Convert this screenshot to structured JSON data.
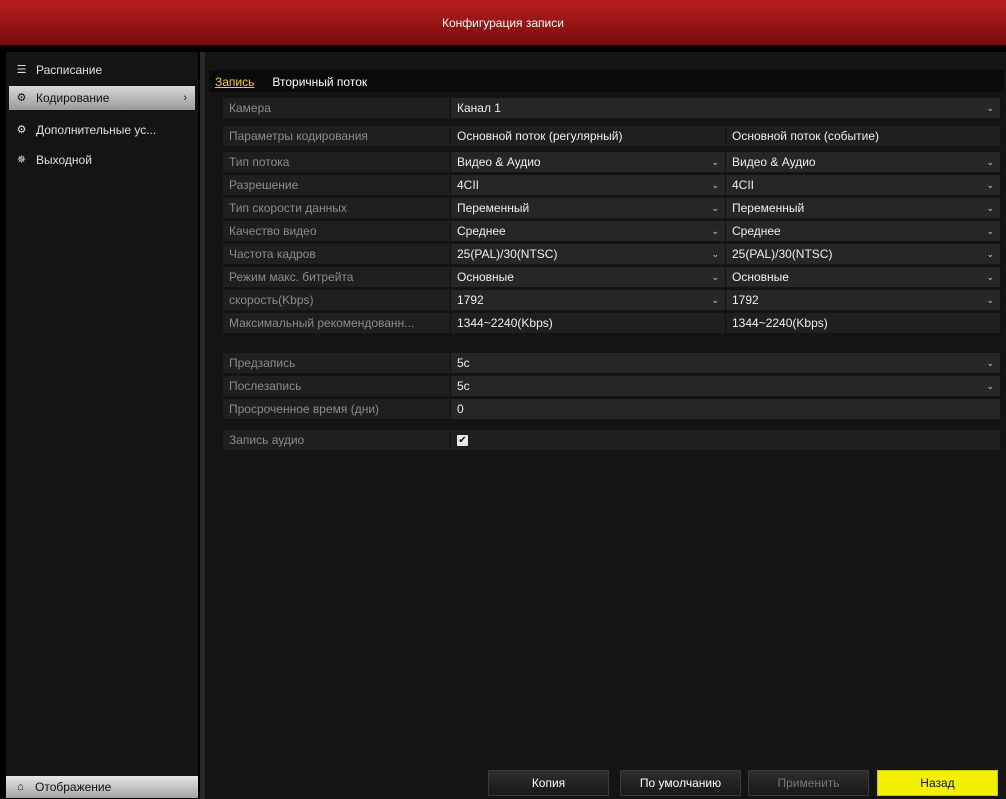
{
  "window": {
    "title": "Конфигурация записи"
  },
  "sidebar": {
    "items": [
      {
        "label": "Расписание",
        "icon": "calendar-icon"
      },
      {
        "label": "Кодирование",
        "icon": "gear-icon",
        "active": true
      },
      {
        "label": "Дополнительные ус...",
        "icon": "settings-icon"
      },
      {
        "label": "Выходной",
        "icon": "holiday-icon"
      }
    ],
    "bottom": {
      "label": "Отображение",
      "icon": "home-icon"
    }
  },
  "tabs": [
    {
      "label": "Запись",
      "active": true
    },
    {
      "label": "Вторичный поток",
      "active": false
    }
  ],
  "form": {
    "camera": {
      "label": "Камера",
      "value": "Канал 1"
    },
    "header": {
      "label": "Параметры кодирования",
      "col1": "Основной поток (регулярный)",
      "col2": "Основной поток (событие)"
    },
    "rows": [
      {
        "label": "Тип потока",
        "v1": "Видео & Аудио",
        "v2": "Видео & Аудио"
      },
      {
        "label": "Разрешение",
        "v1": "4CII",
        "v2": "4CII"
      },
      {
        "label": "Тип скорости данных",
        "v1": "Переменный",
        "v2": "Переменный"
      },
      {
        "label": "Качество видео",
        "v1": "Среднее",
        "v2": "Среднее"
      },
      {
        "label": "Частота кадров",
        "v1": "25(PAL)/30(NTSC)",
        "v2": "25(PAL)/30(NTSC)"
      },
      {
        "label": "Режим макс. битрейта",
        "v1": "Основные",
        "v2": "Основные"
      },
      {
        "label": "скорость(Kbps)",
        "v1": "1792",
        "v2": "1792"
      }
    ],
    "recommended": {
      "label": "Максимальный рекомендованн...",
      "v1": "1344~2240(Kbps)",
      "v2": "1344~2240(Kbps)"
    },
    "prerecord": {
      "label": "Предзапись",
      "value": "5с"
    },
    "postrecord": {
      "label": "Послезапись",
      "value": "5с"
    },
    "expired": {
      "label": "Просроченное время (дни)",
      "value": "0"
    },
    "audio": {
      "label": "Запись аудио",
      "checked": true
    }
  },
  "buttons": {
    "copy": "Копия",
    "default": "По умолчанию",
    "apply": "Применить",
    "back": "Назад"
  },
  "colors": {
    "titlebar": "#a01414",
    "accent": "#f2d000",
    "back_button": "#f5f000"
  }
}
